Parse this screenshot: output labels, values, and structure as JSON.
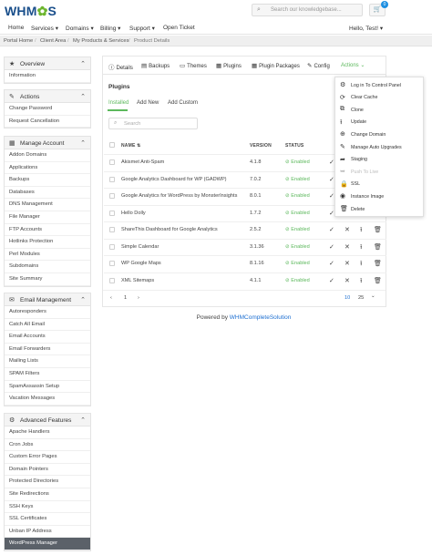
{
  "brand": {
    "logo_text_left": "WHM",
    "logo_gear": "✿",
    "logo_text_right": "S"
  },
  "header": {
    "search_placeholder": "Search our knowledgebase...",
    "cart_count": "0"
  },
  "nav": {
    "items": [
      "Home",
      "Services ▾",
      "Domains ▾",
      "Billing ▾",
      "Support ▾",
      "Open Ticket"
    ],
    "user": "Hello, Test! ▾"
  },
  "breadcrumb": [
    "Portal Home",
    "Client Area",
    "My Products & Services",
    "Product Details"
  ],
  "sidebar": {
    "overview": {
      "title": "Overview",
      "items": [
        "Information"
      ]
    },
    "actions": {
      "title": "Actions",
      "items": [
        "Change Password",
        "Request Cancellation"
      ]
    },
    "manage_account": {
      "title": "Manage Account",
      "items": [
        "Addon Domains",
        "Applications",
        "Backups",
        "Databases",
        "DNS Management",
        "File Manager",
        "FTP Accounts",
        "Hotlinks Protection",
        "Perl Modules",
        "Subdomains",
        "Site Summary"
      ]
    },
    "email_management": {
      "title": "Email Management",
      "items": [
        "Autoresponders",
        "Catch All Email",
        "Email Accounts",
        "Email Forwarders",
        "Mailing Lists",
        "SPAM Filters",
        "SpamAssassin Setup",
        "Vacation Messages"
      ]
    },
    "advanced_features": {
      "title": "Advanced Features",
      "items": [
        "Apache Handlers",
        "Cron Jobs",
        "Custom Error Pages",
        "Domain Pointers",
        "Protected Directories",
        "Site Redirections",
        "SSH Keys",
        "SSL Certificates",
        "Unban IP Address",
        "WordPress Manager"
      ]
    }
  },
  "tabs": [
    "Details",
    "Backups",
    "Themes",
    "Plugins",
    "Plugin Packages",
    "Config",
    "Actions"
  ],
  "plugins": {
    "title": "Plugins",
    "subtabs": [
      "Installed",
      "Add New",
      "Add Custom"
    ],
    "search_placeholder": "Search",
    "columns": {
      "name": "NAME ⇅",
      "version": "VERSION",
      "status": "STATUS"
    },
    "rows": [
      {
        "name": "Akismet Anti-Spam",
        "version": "4.1.8",
        "status": "Enabled"
      },
      {
        "name": "Google Analytics Dashboard for WP (GADWP)",
        "version": "7.0.2",
        "status": "Enabled"
      },
      {
        "name": "Google Analytics for WordPress by MonsterInsights",
        "version": "8.0.1",
        "status": "Enabled"
      },
      {
        "name": "Hello Dolly",
        "version": "1.7.2",
        "status": "Enabled"
      },
      {
        "name": "ShareThis Dashboard for Google Analytics",
        "version": "2.5.2",
        "status": "Enabled"
      },
      {
        "name": "Simple Calendar",
        "version": "3.1.36",
        "status": "Enabled"
      },
      {
        "name": "WP Google Maps",
        "version": "8.1.16",
        "status": "Enabled"
      },
      {
        "name": "XML Sitemaps",
        "version": "4.1.1",
        "status": "Enabled"
      }
    ],
    "pager": {
      "prev": "‹",
      "page": "1",
      "next": "›",
      "per_page_a": "10",
      "per_page_b": "25",
      "per_page_c": "⌄"
    }
  },
  "actions_menu": [
    {
      "icon": "⚙",
      "label": "Log in To Control Panel",
      "disabled": false
    },
    {
      "icon": "⟳",
      "label": "Clear Cache",
      "disabled": false
    },
    {
      "icon": "⧉",
      "label": "Clone",
      "disabled": false
    },
    {
      "icon": "⭱",
      "label": "Update",
      "disabled": false
    },
    {
      "icon": "⊕",
      "label": "Change Domain",
      "disabled": false
    },
    {
      "icon": "✎",
      "label": "Manage Auto Upgrades",
      "disabled": false
    },
    {
      "icon": "➦",
      "label": "Staging",
      "disabled": false
    },
    {
      "icon": "➥",
      "label": "Push To Live",
      "disabled": true
    },
    {
      "icon": "🔒",
      "label": "SSL",
      "disabled": false
    },
    {
      "icon": "◉",
      "label": "Instance Image",
      "disabled": false
    },
    {
      "icon": "🗑",
      "label": "Delete",
      "disabled": false
    }
  ],
  "footer": {
    "prefix": "Powered by ",
    "link": "WHMCompleteSolution"
  },
  "colors": {
    "accent": "#5cb85c",
    "brand": "#1a4f8b",
    "link": "#1d6fd1"
  }
}
